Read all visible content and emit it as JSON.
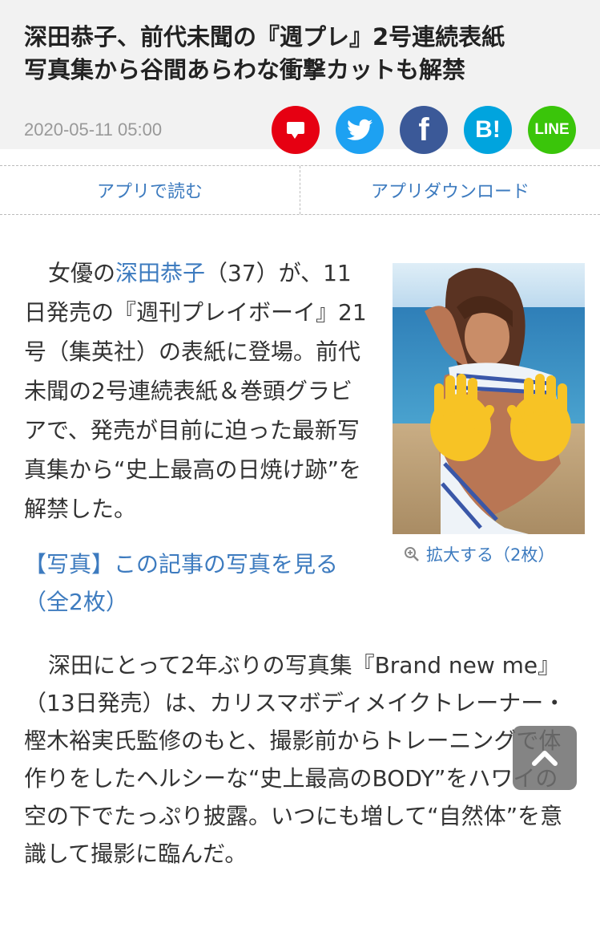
{
  "header": {
    "title_line1": "深田恭子、前代未聞の『週プレ』2号連続表紙",
    "title_line2": "写真集から谷間あらわな衝撃カットも解禁",
    "date": "2020-05-11 05:00",
    "share": {
      "facebook": "f",
      "hatena": "B!",
      "line": "LINE"
    }
  },
  "appbar": {
    "read_in_app": "アプリで読む",
    "download_app": "アプリダウンロード"
  },
  "article": {
    "lead_prefix": "女優の",
    "lead_link": "深田恭子",
    "lead_rest": "（37）が、11日発売の『週刊プレイボーイ』21号（集英社）の表紙に登場。前代未聞の2号連続表紙＆巻頭グラビアで、発売が目前に迫った最新写真集から“史上最高の日焼け跡”を解禁した。",
    "photo_link": "【写真】この記事の写真を見る（全2枚）",
    "zoom_label": "拡大する（2枚）",
    "para2": "深田にとって2年ぶりの写真集『Brand new me』（13日発売）は、カリスマボディメイクトレーナー・樫木裕実氏監修のもと、撮影前からトレーニングで体作りをしたヘルシーな“史上最高のBODY”をハワイの空の下でたっぷり披露。いつにも増して“自然体”を意識して撮影に臨んだ。"
  },
  "colors": {
    "link": "#3d7bbf",
    "comment": "#e60012",
    "twitter": "#1da1f2",
    "facebook": "#3b5998",
    "hatena": "#00a4de",
    "line": "#3ac50a"
  },
  "icons": [
    "comment-icon",
    "twitter-icon",
    "facebook-icon",
    "hatena-icon",
    "line-icon",
    "zoom-icon",
    "chevron-up-icon"
  ]
}
